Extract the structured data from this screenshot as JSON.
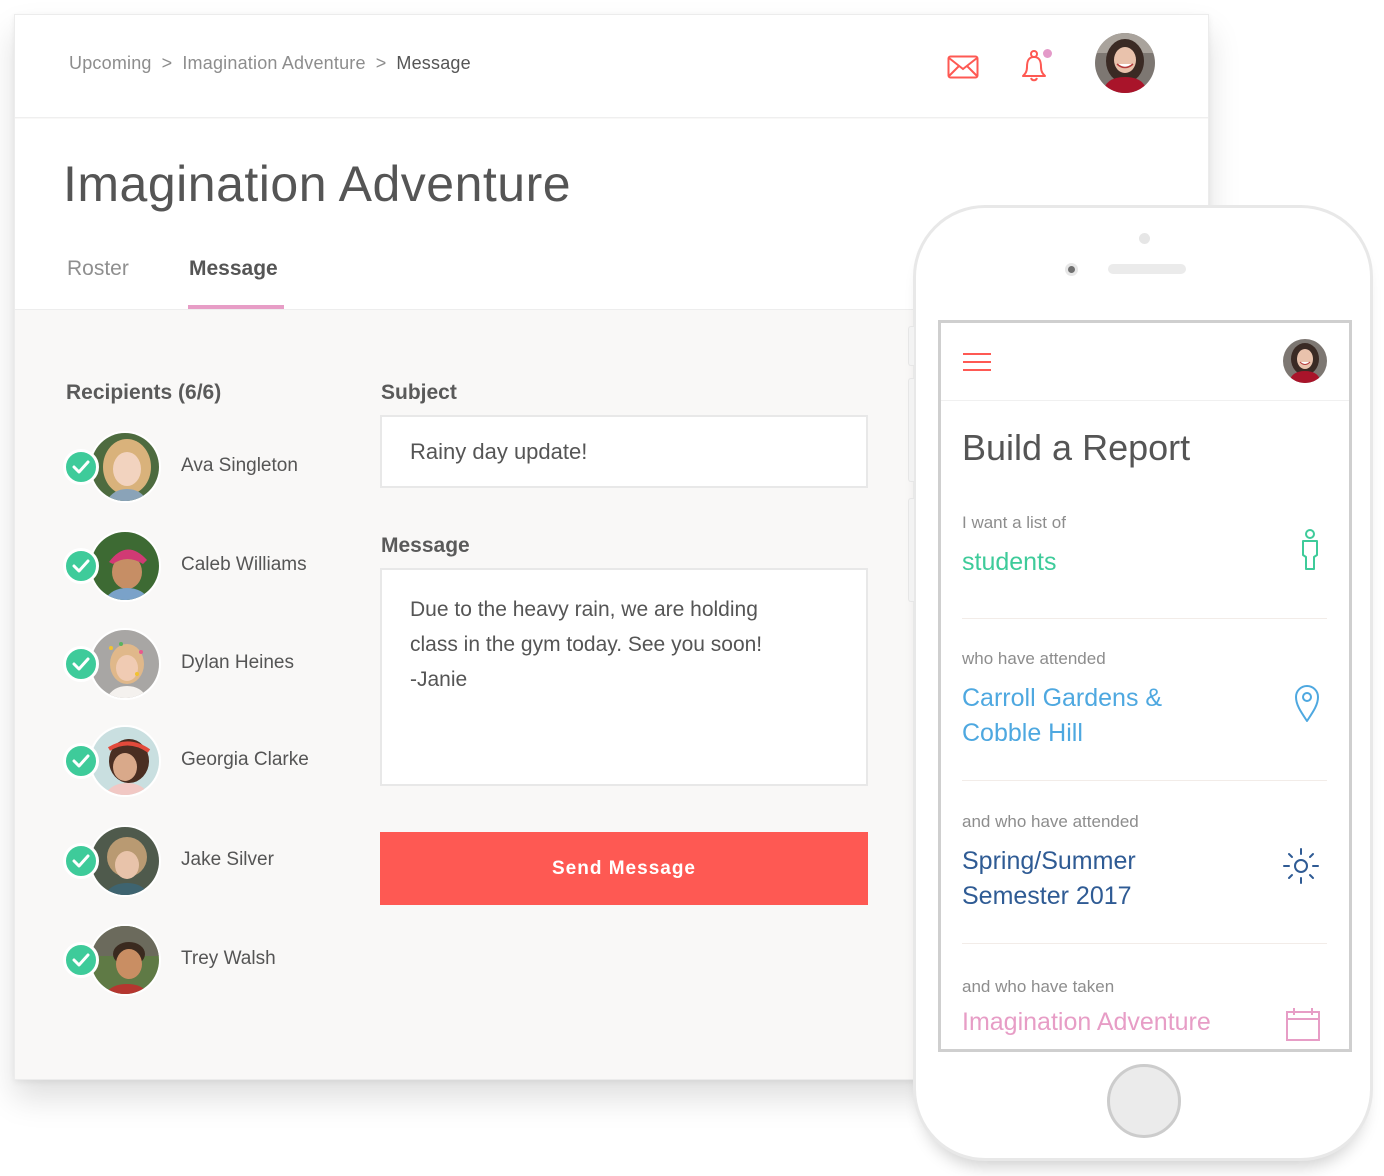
{
  "desktop": {
    "breadcrumb": [
      {
        "label": "Upcoming"
      },
      {
        "label": "Imagination Adventure"
      },
      {
        "label": "Message"
      }
    ],
    "breadcrumb_separator": ">",
    "icons": {
      "mail": "mail-icon",
      "notifications": "bell-icon",
      "user": "user-avatar"
    },
    "page_title": "Imagination Adventure",
    "tabs": [
      {
        "label": "Roster",
        "active": false
      },
      {
        "label": "Message",
        "active": true
      }
    ],
    "recipients_label": "Recipients (6/6)",
    "recipients": [
      {
        "name": "Ava Singleton",
        "checked": true
      },
      {
        "name": "Caleb Williams",
        "checked": true
      },
      {
        "name": "Dylan Heines",
        "checked": true
      },
      {
        "name": "Georgia Clarke",
        "checked": true
      },
      {
        "name": "Jake Silver",
        "checked": true
      },
      {
        "name": "Trey Walsh",
        "checked": true
      }
    ],
    "subject_label": "Subject",
    "subject_value": "Rainy day update!",
    "message_label": "Message",
    "message_value": "Due to the heavy rain, we are holding\nclass in the gym today. See you soon!\n-Janie",
    "send_button": "Send Message"
  },
  "mobile": {
    "title": "Build a Report",
    "rows": [
      {
        "label": "I want a list of",
        "value": "students",
        "icon": "person-icon",
        "color": "#3ecb9a"
      },
      {
        "label": "who have attended",
        "value": "Carroll Gardens &\nCobble Hill",
        "icon": "location-pin-icon",
        "color": "#4ea8e0"
      },
      {
        "label": "and who have attended",
        "value": "Spring/Summer\nSemester 2017",
        "icon": "sun-icon",
        "color": "#2f5b94"
      },
      {
        "label": "and who have taken",
        "value": "Imagination Adventure",
        "icon": "calendar-icon",
        "color": "#e79dc6"
      }
    ]
  },
  "colors": {
    "accent_red": "#fe5953",
    "accent_pink": "#e79dc6",
    "check_green": "#3ecb9a",
    "location_blue": "#4ea8e0",
    "semester_navy": "#2f5b94"
  }
}
